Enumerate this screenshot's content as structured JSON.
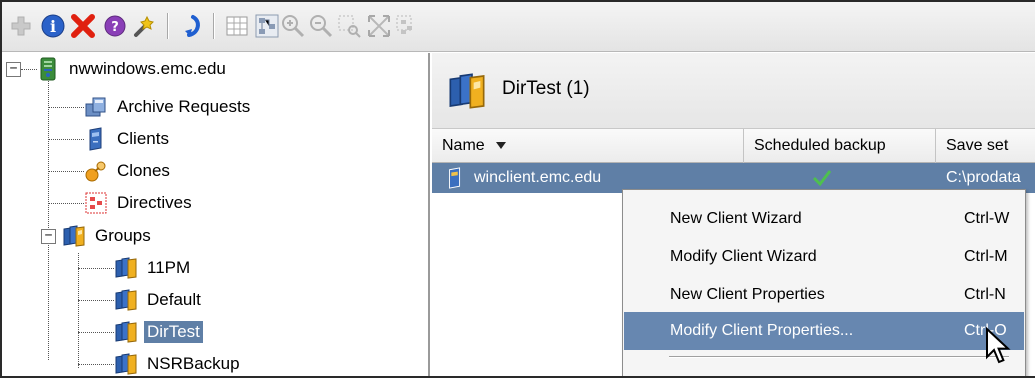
{
  "toolbar": {
    "buttons": [
      {
        "name": "add-icon"
      },
      {
        "name": "info-icon"
      },
      {
        "name": "delete-icon"
      },
      {
        "name": "help-icon"
      },
      {
        "name": "wand-icon"
      },
      {
        "name": "refresh-icon"
      },
      {
        "name": "table-view-icon"
      },
      {
        "name": "tree-view-icon"
      },
      {
        "name": "zoom-in-icon"
      },
      {
        "name": "zoom-out-icon"
      },
      {
        "name": "zoom-area-icon"
      },
      {
        "name": "fit-icon"
      },
      {
        "name": "overview-icon"
      }
    ]
  },
  "tree": {
    "root": {
      "label": "nwwindows.emc.edu",
      "icon": "server-icon",
      "expanded": true
    },
    "items": [
      {
        "label": "Archive Requests",
        "icon": "archive-requests-icon"
      },
      {
        "label": "Clients",
        "icon": "client-icon"
      },
      {
        "label": "Clones",
        "icon": "clones-icon"
      },
      {
        "label": "Directives",
        "icon": "directives-icon"
      },
      {
        "label": "Groups",
        "icon": "groups-icon",
        "expanded": true
      }
    ],
    "groups": [
      {
        "label": "11PM",
        "selected": false
      },
      {
        "label": "Default",
        "selected": false
      },
      {
        "label": "DirTest",
        "selected": true
      },
      {
        "label": "NSRBackup",
        "selected": false
      }
    ]
  },
  "right_pane": {
    "title": "DirTest (1)",
    "columns": [
      {
        "label": "Name",
        "sort": "descending"
      },
      {
        "label": "Scheduled backup"
      },
      {
        "label": "Save set"
      }
    ],
    "rows": [
      {
        "name": "winclient.emc.edu",
        "scheduled_backup": true,
        "save_set": "C:\\prodata"
      }
    ]
  },
  "context_menu": {
    "items": [
      {
        "label": "New Client Wizard",
        "shortcut": "Ctrl-W"
      },
      {
        "label": "Modify Client Wizard",
        "shortcut": "Ctrl-M"
      },
      {
        "label": "New Client Properties",
        "shortcut": "Ctrl-N"
      },
      {
        "label": "Modify Client Properties...",
        "shortcut": "Ctrl-O",
        "highlighted": true
      }
    ]
  },
  "colors": {
    "selection": "#5f7fa6",
    "menu_highlight": "#6787b0",
    "check": "#3aa83a"
  }
}
